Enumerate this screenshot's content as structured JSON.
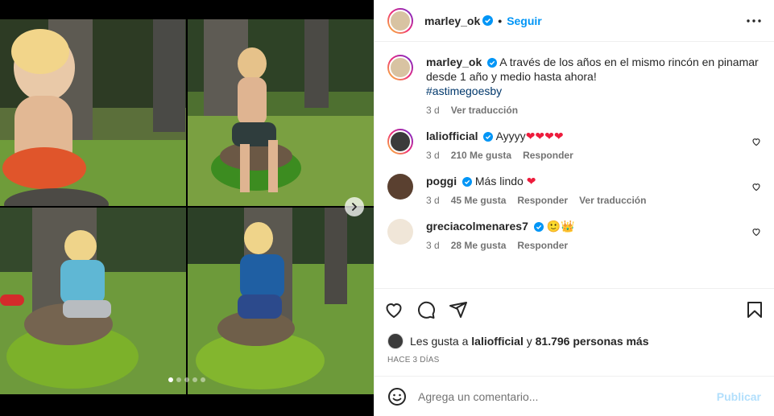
{
  "post": {
    "username": "marley_ok",
    "follow_label": "Seguir",
    "separator": "•",
    "caption": "A través de los años en el mismo rincón en pinamar desde 1 año y medio hasta ahora!",
    "hashtag": "#astimegoesby",
    "caption_age": "3 d",
    "translate": "Ver traducción"
  },
  "comments": [
    {
      "user": "laliofficial",
      "text": "Ayyyy",
      "hearts": "❤❤❤❤",
      "age": "3 d",
      "likes": "210 Me gusta",
      "reply": "Responder",
      "translate": ""
    },
    {
      "user": "poggi",
      "text": "Más lindo",
      "hearts": "❤",
      "age": "3 d",
      "likes": "45 Me gusta",
      "reply": "Responder",
      "translate": "Ver traducción"
    },
    {
      "user": "greciacolmenares7",
      "text": "",
      "hearts": "🙂👑",
      "age": "3 d",
      "likes": "28 Me gusta",
      "reply": "Responder",
      "translate": ""
    }
  ],
  "likes_summary": {
    "prefix": "Les gusta a",
    "user": "laliofficial",
    "and": "y",
    "count": "81.796 personas más"
  },
  "time_ago": "HACE 3 DÍAS",
  "add_comment": {
    "placeholder": "Agrega un comentario...",
    "publish": "Publicar"
  },
  "carousel": {
    "current": 1,
    "total": 5
  },
  "colors": {
    "accent": "#0095f6",
    "publish_disabled": "#b2dffc",
    "heart": "#ed1c3c"
  },
  "icons": [
    "verified-icon",
    "more-icon",
    "heart-icon",
    "comment-icon",
    "share-icon",
    "bookmark-icon",
    "emoji-icon",
    "chevron-right-icon"
  ]
}
